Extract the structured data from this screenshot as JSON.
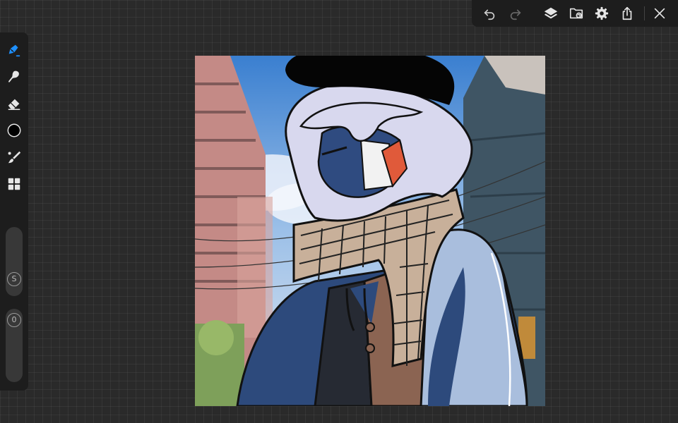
{
  "app": {
    "accent_color": "#1e90ff",
    "panel_color": "#1d1d1d",
    "background_color": "#2a2a2a"
  },
  "top_toolbar": {
    "items": [
      "undo-icon",
      "redo-icon",
      "layers-icon",
      "gallery-icon",
      "settings-gear-icon",
      "share-icon",
      "close-icon"
    ]
  },
  "left_toolbar": {
    "tools": [
      "pen-icon",
      "smudge-brush-icon",
      "eraser-icon",
      "color-swatch",
      "brush-library-icon",
      "grid-icon"
    ],
    "active_tool": "pen-icon",
    "current_color": "#000000",
    "size_slider": {
      "label": "S"
    },
    "opacity_slider": {
      "label": "0"
    }
  },
  "canvas": {
    "content": "artwork"
  }
}
